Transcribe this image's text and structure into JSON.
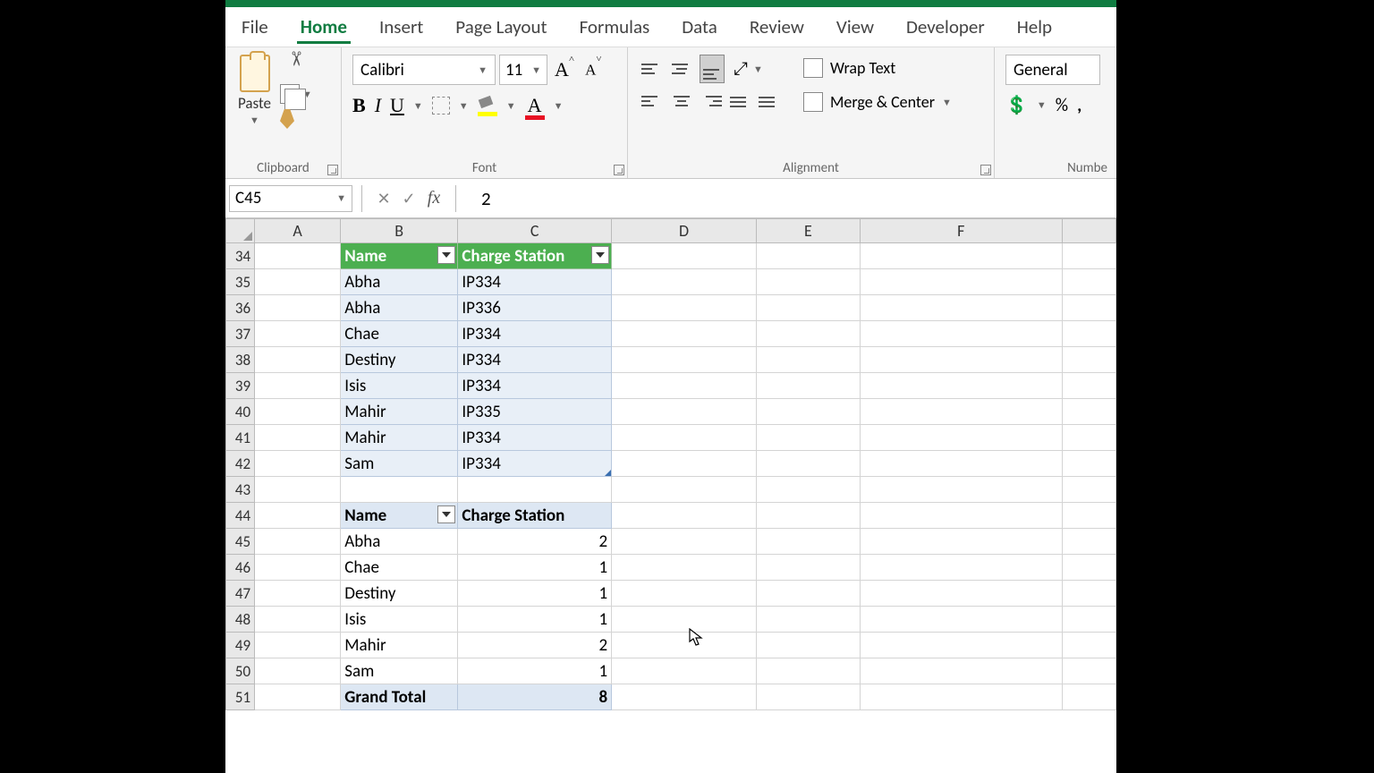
{
  "tabs": {
    "file": "File",
    "home": "Home",
    "insert": "Insert",
    "pagelayout": "Page Layout",
    "formulas": "Formulas",
    "data": "Data",
    "review": "Review",
    "view": "View",
    "developer": "Developer",
    "help": "Help"
  },
  "ribbon": {
    "clipboard": {
      "label": "Clipboard",
      "paste": "Paste"
    },
    "font": {
      "label": "Font",
      "name": "Calibri",
      "size": "11"
    },
    "alignment": {
      "label": "Alignment",
      "wrap": "Wrap Text",
      "merge": "Merge & Center"
    },
    "number": {
      "label": "Numbe",
      "format": "General"
    }
  },
  "formula_bar": {
    "name_box": "C45",
    "value": "2"
  },
  "columns": [
    "A",
    "B",
    "C",
    "D",
    "E",
    "F"
  ],
  "rows_visible": [
    "34",
    "35",
    "36",
    "37",
    "38",
    "39",
    "40",
    "41",
    "42",
    "43",
    "44",
    "45",
    "46",
    "47",
    "48",
    "49",
    "50",
    "51"
  ],
  "table1": {
    "headers": {
      "b": "Name",
      "c": "Charge Station"
    },
    "rows": [
      {
        "name": "Abha",
        "station": "IP334"
      },
      {
        "name": "Abha",
        "station": "IP336"
      },
      {
        "name": "Chae",
        "station": "IP334"
      },
      {
        "name": "Destiny",
        "station": "IP334"
      },
      {
        "name": "Isis",
        "station": "IP334"
      },
      {
        "name": "Mahir",
        "station": "IP335"
      },
      {
        "name": "Mahir",
        "station": "IP334"
      },
      {
        "name": "Sam",
        "station": "IP334"
      }
    ]
  },
  "pivot": {
    "headers": {
      "b": "Name",
      "c": "Charge Station"
    },
    "rows": [
      {
        "name": "Abha",
        "count": "2"
      },
      {
        "name": "Chae",
        "count": "1"
      },
      {
        "name": "Destiny",
        "count": "1"
      },
      {
        "name": "Isis",
        "count": "1"
      },
      {
        "name": "Mahir",
        "count": "2"
      },
      {
        "name": "Sam",
        "count": "1"
      }
    ],
    "total_label": "Grand Total",
    "total_value": "8"
  }
}
